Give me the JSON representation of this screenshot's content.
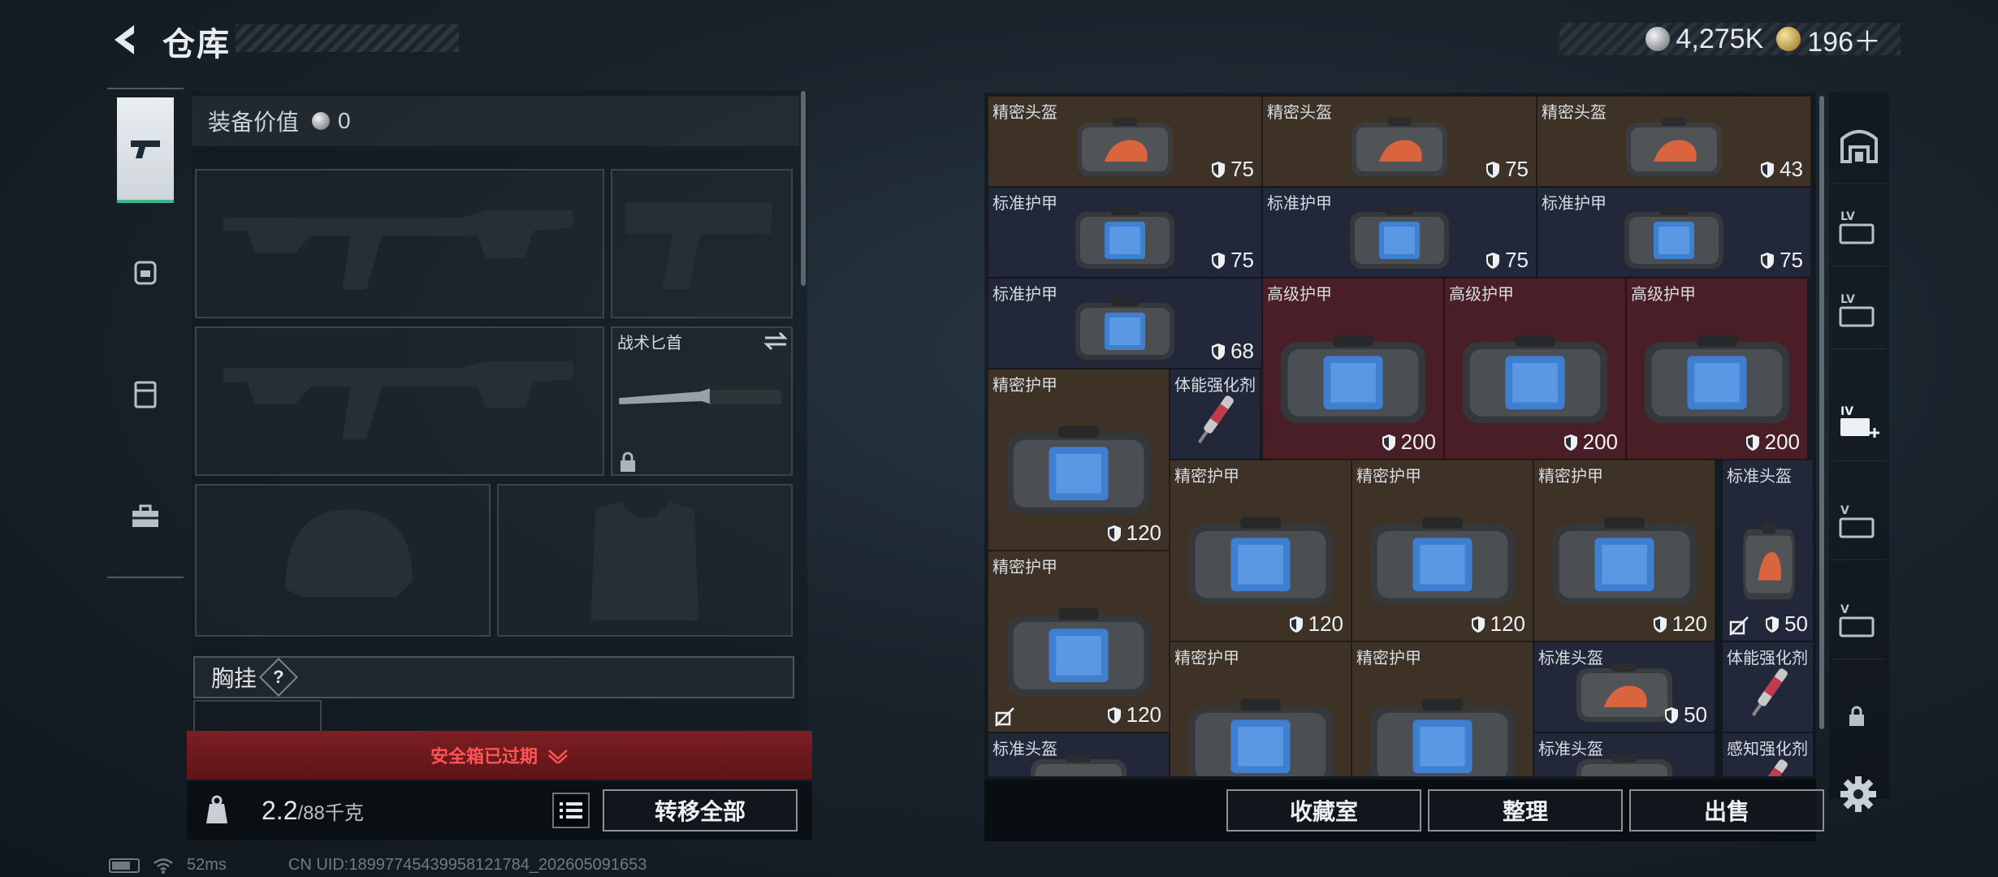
{
  "header": {
    "title": "仓库"
  },
  "currency": {
    "silver": "4,275K",
    "gold": "196＋"
  },
  "equipment": {
    "value_label": "装备价值",
    "value": "0",
    "knife_label": "战术匕首",
    "chest_rig_label": "胸挂",
    "chest_rig_help": "?",
    "safe_box_status": "安全箱已过期",
    "weight_current": "2.2",
    "weight_capacity": "/88千克",
    "transfer_all": "转移全部"
  },
  "storage": {
    "items": [
      {
        "name": "精密头盔",
        "durability": "75",
        "bg": "brown",
        "kind": "helmet"
      },
      {
        "name": "精密头盔",
        "durability": "75",
        "bg": "brown",
        "kind": "helmet"
      },
      {
        "name": "精密头盔",
        "durability": "43",
        "bg": "brown",
        "kind": "helmet"
      },
      {
        "name": "标准护甲",
        "durability": "75",
        "bg": "navy",
        "kind": "armor"
      },
      {
        "name": "标准护甲",
        "durability": "75",
        "bg": "navy",
        "kind": "armor"
      },
      {
        "name": "标准护甲",
        "durability": "75",
        "bg": "navy",
        "kind": "armor"
      },
      {
        "name": "标准护甲",
        "durability": "68",
        "bg": "navy",
        "kind": "armor"
      },
      {
        "name": "高级护甲",
        "durability": "200",
        "bg": "red",
        "kind": "armor-lg"
      },
      {
        "name": "高级护甲",
        "durability": "200",
        "bg": "red",
        "kind": "armor-lg"
      },
      {
        "name": "高级护甲",
        "durability": "200",
        "bg": "red",
        "kind": "armor-lg"
      },
      {
        "name": "精密护甲",
        "durability": "120",
        "bg": "brown",
        "kind": "armor-lg"
      },
      {
        "name": "体能强化剂",
        "durability": "",
        "bg": "navy",
        "kind": "syringe"
      },
      {
        "name": "精密护甲",
        "durability": "120",
        "bg": "brown",
        "kind": "armor-lg"
      },
      {
        "name": "精密护甲",
        "durability": "120",
        "bg": "brown",
        "kind": "armor-lg"
      },
      {
        "name": "精密护甲",
        "durability": "120",
        "bg": "brown",
        "kind": "armor-lg"
      },
      {
        "name": "标准头盔",
        "durability": "50",
        "bg": "navy",
        "kind": "helmet-tall"
      },
      {
        "name": "精密护甲",
        "durability": "120",
        "bg": "brown",
        "kind": "armor-lg"
      },
      {
        "name": "精密护甲",
        "durability": "",
        "bg": "brown",
        "kind": "armor-lg"
      },
      {
        "name": "精密护甲",
        "durability": "",
        "bg": "brown",
        "kind": "armor-lg"
      },
      {
        "name": "标准头盔",
        "durability": "50",
        "bg": "navy",
        "kind": "helmet"
      },
      {
        "name": "体能强化剂",
        "durability": "",
        "bg": "navy",
        "kind": "syringe"
      },
      {
        "name": "标准头盔",
        "durability": "",
        "bg": "navy",
        "kind": "helmet"
      },
      {
        "name": "标准头盔",
        "durability": "",
        "bg": "navy",
        "kind": "helmet"
      },
      {
        "name": "感知强化剂",
        "durability": "",
        "bg": "navy",
        "kind": "syringe"
      }
    ],
    "buttons": {
      "collection": "收藏室",
      "organize": "整理",
      "sell": "出售"
    }
  },
  "status": {
    "ping": "52ms",
    "uid": "CN UID:18997745439958121784_202605091653"
  },
  "colors": {
    "accent_green": "#3bb88a",
    "warning_red": "#ff5555"
  }
}
